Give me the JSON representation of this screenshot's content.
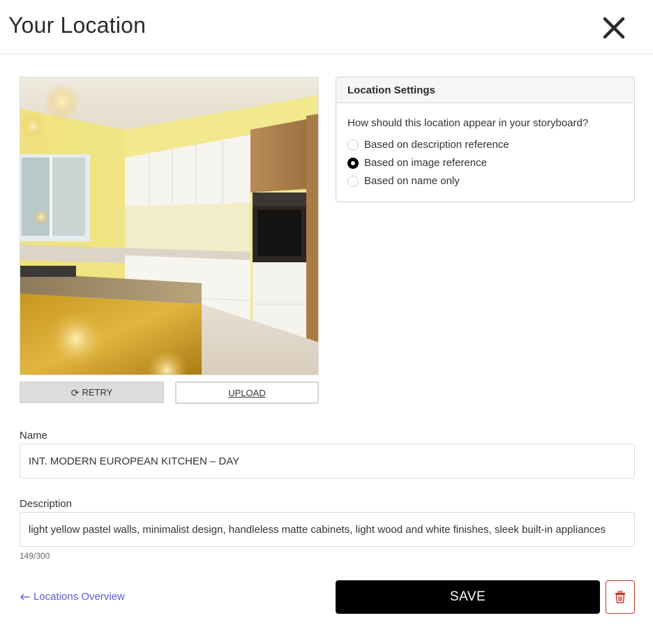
{
  "header": {
    "title": "Your Location"
  },
  "icons": {
    "close": "close-icon",
    "retry": "refresh-icon",
    "back": "arrow-left-icon",
    "delete": "trash-icon"
  },
  "media": {
    "retry_label": "RETRY",
    "upload_label": "UPLOAD"
  },
  "settings": {
    "title": "Location Settings",
    "question": "How should this location appear in your storyboard?",
    "options": [
      {
        "label": "Based on description reference",
        "selected": false
      },
      {
        "label": "Based on image reference",
        "selected": true
      },
      {
        "label": "Based on name only",
        "selected": false
      }
    ]
  },
  "form": {
    "name_label": "Name",
    "name_value": "INT. MODERN EUROPEAN KITCHEN – DAY",
    "description_label": "Description",
    "description_value": "light yellow pastel walls, minimalist design, handleless matte cabinets, light wood and white finishes, sleek built-in appliances",
    "char_count": "149/300"
  },
  "footer": {
    "back_label": "Locations Overview",
    "save_label": "SAVE"
  },
  "colors": {
    "accent_link": "#5b5bd6",
    "save_bg": "#000000",
    "delete_border": "#c0392b"
  }
}
